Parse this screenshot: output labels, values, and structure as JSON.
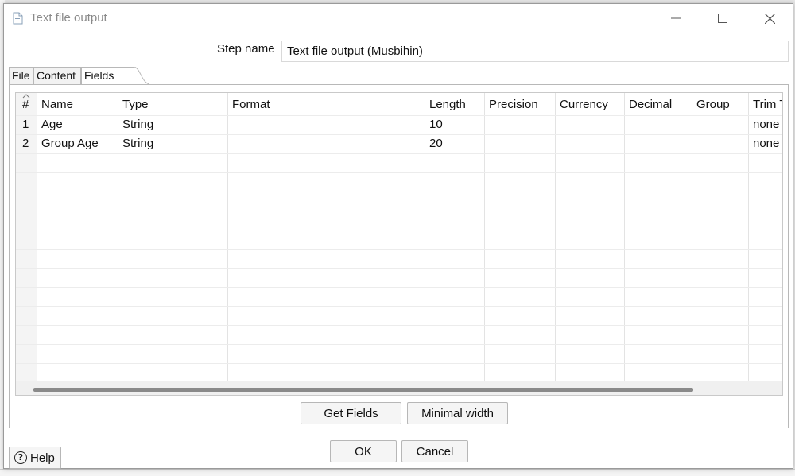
{
  "window": {
    "title": "Text file output",
    "icon": "document-icon",
    "controls": [
      "minimize",
      "maximize",
      "close"
    ]
  },
  "step": {
    "label": "Step name",
    "value": "Text file output (Musbihin)"
  },
  "tabs": [
    {
      "label": "File",
      "selected": false
    },
    {
      "label": "Content",
      "selected": false
    },
    {
      "label": "Fields",
      "selected": true
    }
  ],
  "grid": {
    "columns": [
      "#",
      "Name",
      "Type",
      "Format",
      "Length",
      "Precision",
      "Currency",
      "Decimal",
      "Group",
      "Trim T"
    ],
    "rows": [
      {
        "num": "1",
        "name": "Age",
        "type": "String",
        "format": "",
        "length": "10",
        "precision": "",
        "currency": "",
        "decimal": "",
        "group": "",
        "trim": "none"
      },
      {
        "num": "2",
        "name": "Group Age",
        "type": "String",
        "format": "",
        "length": "20",
        "precision": "",
        "currency": "",
        "decimal": "",
        "group": "",
        "trim": "none"
      }
    ]
  },
  "buttons": {
    "get_fields": "Get Fields",
    "minimal_width": "Minimal width",
    "ok": "OK",
    "cancel": "Cancel",
    "help": "Help"
  },
  "colors": {
    "title_text": "#8a8a8a",
    "scroll_thumb": "#8a8a8a",
    "border": "#b8b8b8"
  }
}
